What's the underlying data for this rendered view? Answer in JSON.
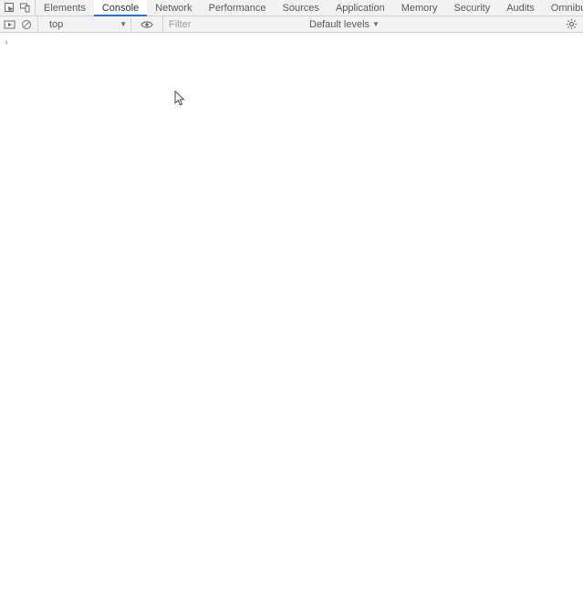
{
  "tabs": {
    "items": [
      "Elements",
      "Console",
      "Network",
      "Performance",
      "Sources",
      "Application",
      "Memory",
      "Security",
      "Audits",
      "Omnibug"
    ],
    "active": "Console"
  },
  "toolbar": {
    "context": "top",
    "filter_placeholder": "Filter",
    "levels_label": "Default levels"
  },
  "prompt": "›"
}
